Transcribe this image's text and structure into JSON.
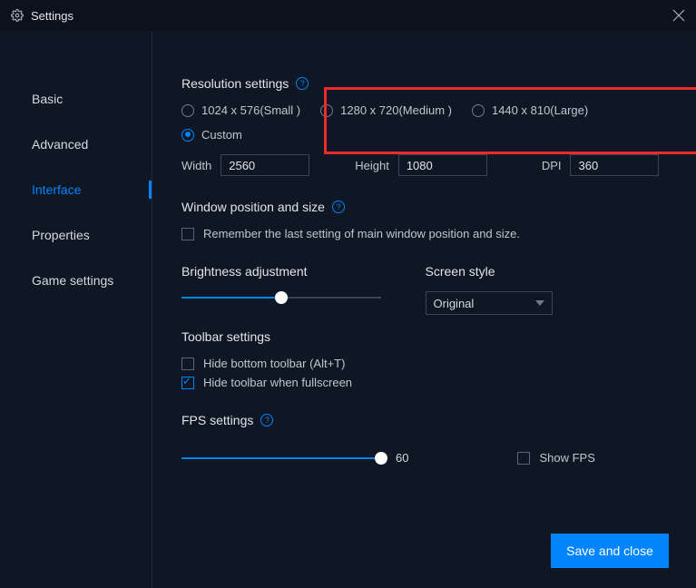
{
  "titlebar": {
    "title": "Settings"
  },
  "sidebar": {
    "items": [
      {
        "label": "Basic"
      },
      {
        "label": "Advanced"
      },
      {
        "label": "Interface"
      },
      {
        "label": "Properties"
      },
      {
        "label": "Game settings"
      }
    ],
    "active_index": 2
  },
  "resolution": {
    "title": "Resolution settings",
    "options": [
      "1024 x 576(Small )",
      "1280 x 720(Medium )",
      "1440 x 810(Large)"
    ],
    "custom_label": "Custom",
    "width_label": "Width",
    "width_value": "2560",
    "height_label": "Height",
    "height_value": "1080",
    "dpi_label": "DPI",
    "dpi_value": "360"
  },
  "window_pos": {
    "title": "Window position and size",
    "remember_label": "Remember the last setting of main window position and size.",
    "remember_checked": false
  },
  "brightness": {
    "title": "Brightness adjustment",
    "value_pct": 50
  },
  "screen_style": {
    "title": "Screen style",
    "selected": "Original"
  },
  "toolbar": {
    "title": "Toolbar settings",
    "hide_bottom_label": "Hide bottom toolbar (Alt+T)",
    "hide_bottom_checked": false,
    "hide_fullscreen_label": "Hide toolbar when fullscreen",
    "hide_fullscreen_checked": true
  },
  "fps": {
    "title": "FPS settings",
    "value": "60",
    "value_pct": 100,
    "show_label": "Show FPS",
    "show_checked": false
  },
  "footer": {
    "save_label": "Save and close"
  }
}
